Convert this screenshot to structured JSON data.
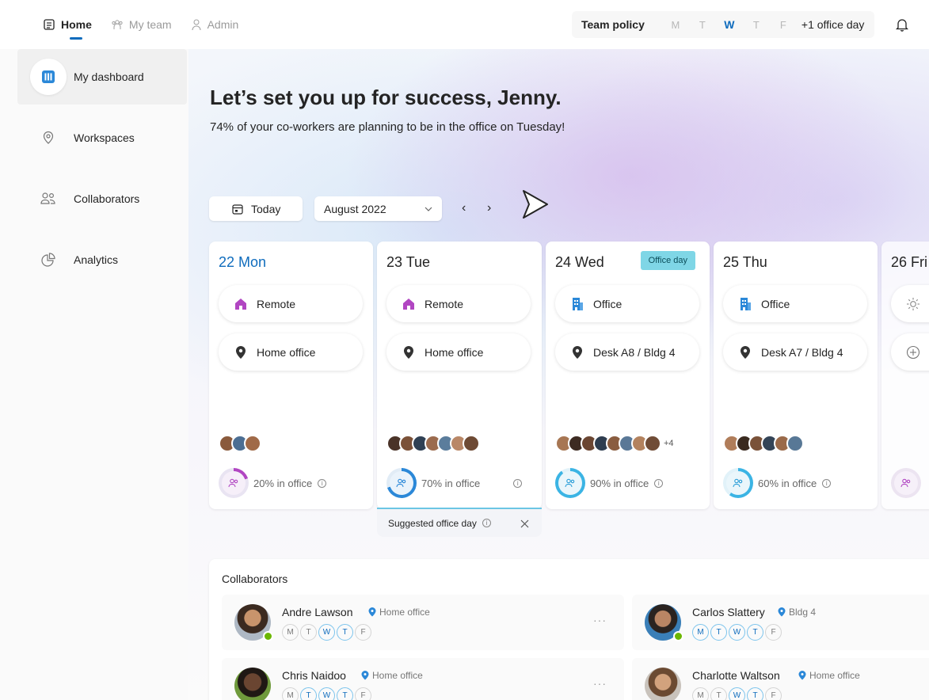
{
  "nav": {
    "tabs": [
      {
        "label": "Home",
        "active": true,
        "icon": "home-list-icon"
      },
      {
        "label": "My team",
        "icon": "team-icon"
      },
      {
        "label": "Admin",
        "icon": "person-icon"
      }
    ]
  },
  "policy": {
    "label": "Team policy",
    "days": [
      "M",
      "T",
      "W",
      "T",
      "F"
    ],
    "highlight_index": 2,
    "extra": "+1 office day"
  },
  "sidebar": {
    "items": [
      {
        "label": "My dashboard",
        "icon": "dashboard-icon",
        "active": true
      },
      {
        "label": "Workspaces",
        "icon": "location-icon"
      },
      {
        "label": "Collaborators",
        "icon": "people-icon"
      },
      {
        "label": "Analytics",
        "icon": "pie-chart-icon"
      }
    ]
  },
  "hero": {
    "title": "Let’s set you up for success, Jenny.",
    "subtitle": "74% of your co-workers are planning to be in the office on Tuesday!"
  },
  "controls": {
    "today": "Today",
    "month": "August 2022",
    "prev": "‹",
    "next": "›"
  },
  "days": [
    {
      "num": "22",
      "name": "Mon",
      "mode": "Remote",
      "mode_icon": "house-icon",
      "location": "Home office",
      "occupancy": "20% in office",
      "percent": 20,
      "extra_count": ""
    },
    {
      "num": "23",
      "name": "Tue",
      "mode": "Remote",
      "mode_icon": "house-icon",
      "location": "Home office",
      "occupancy": "70% in office",
      "percent": 70,
      "extra_count": ""
    },
    {
      "num": "24",
      "name": "Wed",
      "badge": "Office day",
      "mode": "Office",
      "mode_icon": "building-icon",
      "location": "Desk A8 / Bldg 4",
      "occupancy": "90% in office",
      "percent": 90,
      "extra_count": "+4"
    },
    {
      "num": "25",
      "name": "Thu",
      "mode": "Office",
      "mode_icon": "building-icon",
      "location": "Desk A7 / Bldg 4",
      "occupancy": "60% in office",
      "percent": 60,
      "extra_count": ""
    },
    {
      "num": "26",
      "name": "Fri"
    }
  ],
  "suggest": {
    "label": "Suggested office day"
  },
  "collaborators": {
    "title": "Collaborators",
    "people": [
      {
        "name": "Andre Lawson",
        "location": "Home office",
        "days": [
          "M",
          "T",
          "W",
          "T",
          "F"
        ],
        "office_days": [
          2,
          3
        ]
      },
      {
        "name": "Carlos Slattery",
        "location": "Bldg 4",
        "days": [
          "M",
          "T",
          "W",
          "T",
          "F"
        ],
        "office_days": [
          0,
          1,
          2,
          3
        ]
      },
      {
        "name": "Chris Naidoo",
        "location": "Home office",
        "days": [
          "M",
          "T",
          "W",
          "T",
          "F"
        ],
        "office_days": [
          1,
          2,
          3
        ]
      },
      {
        "name": "Charlotte Waltson",
        "location": "Home office",
        "days": [
          "M",
          "T",
          "W",
          "T",
          "F"
        ],
        "office_days": [
          2,
          3
        ]
      }
    ]
  },
  "colors": {
    "accent": "#0f6cbd",
    "remote": "#b146c2",
    "office": "#2b88d8",
    "badge": "#7fd6e6",
    "online": "#6bb700"
  }
}
